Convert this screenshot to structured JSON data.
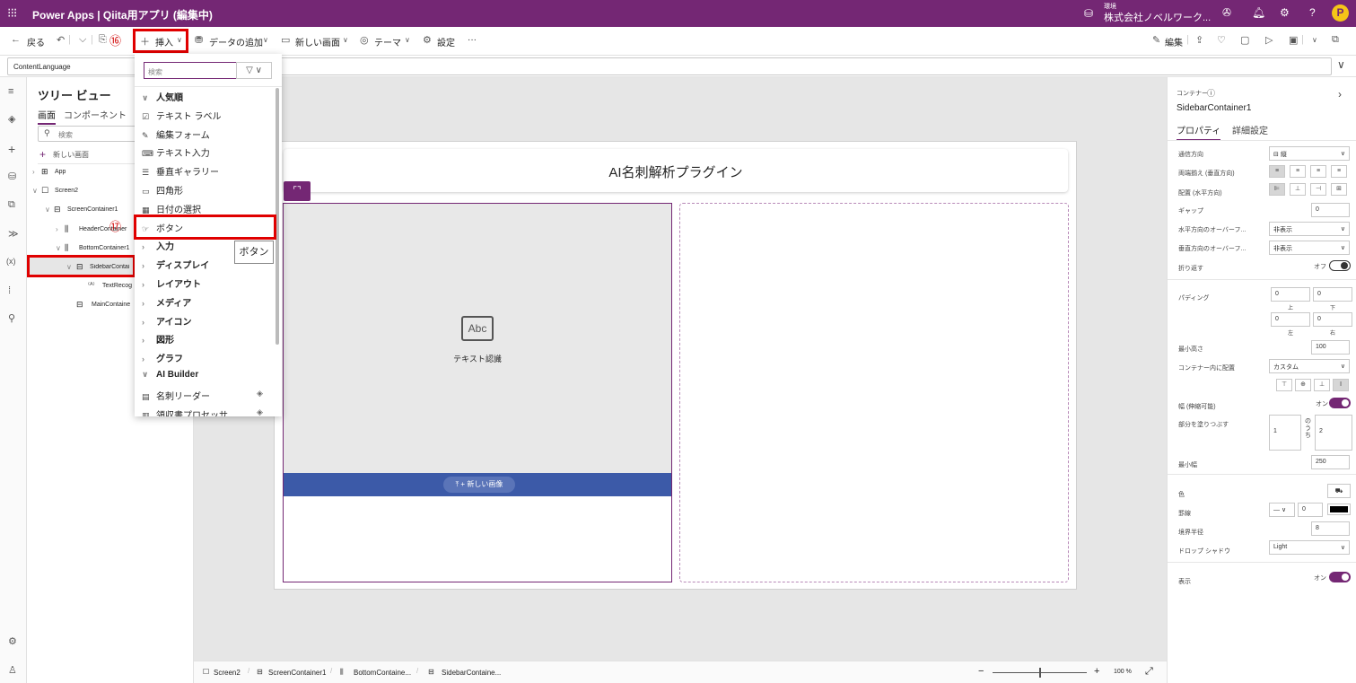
{
  "topbar": {
    "app_title": "Power Apps  |  Qiita用アプリ (編集中)",
    "env_label": "環境",
    "env_name": "株式会社ノベルワーク...",
    "avatar_letter": "P"
  },
  "cmdbar": {
    "back": "戻る",
    "step16": "⑯",
    "insert": "挿入",
    "add_data": "データの追加",
    "new_screen": "新しい画面",
    "theme": "テーマ",
    "settings": "設定",
    "more": "···",
    "edit": "編集"
  },
  "formula": {
    "property": "ContentLanguage"
  },
  "tree": {
    "title": "ツリー ビュー",
    "tab_screens": "画面",
    "tab_components": "コンポーネント",
    "search_placeholder": "検索",
    "new_screen": "新しい画面",
    "nodes": [
      "App",
      "Screen2",
      "ScreenContainer1",
      "HeaderContainer",
      "BottomContainer1",
      "SidebarContai",
      "TextRecog",
      "MainContaine"
    ]
  },
  "insert_menu": {
    "search_placeholder": "検索",
    "items": [
      {
        "label": "人気順",
        "kind": "cat-open"
      },
      {
        "label": "テキスト ラベル",
        "kind": "item",
        "icon": "label-icon"
      },
      {
        "label": "編集フォーム",
        "kind": "item",
        "icon": "form-icon"
      },
      {
        "label": "テキスト入力",
        "kind": "item",
        "icon": "textinput-icon"
      },
      {
        "label": "垂直ギャラリー",
        "kind": "item",
        "icon": "gallery-icon"
      },
      {
        "label": "四角形",
        "kind": "item",
        "icon": "rectangle-icon"
      },
      {
        "label": "日付の選択",
        "kind": "item",
        "icon": "calendar-icon"
      },
      {
        "label": "ボタン",
        "kind": "item",
        "icon": "button-icon"
      },
      {
        "label": "入力",
        "kind": "cat"
      },
      {
        "label": "ディスプレイ",
        "kind": "cat"
      },
      {
        "label": "レイアウト",
        "kind": "cat"
      },
      {
        "label": "メディア",
        "kind": "cat"
      },
      {
        "label": "アイコン",
        "kind": "cat"
      },
      {
        "label": "図形",
        "kind": "cat"
      },
      {
        "label": "グラフ",
        "kind": "cat"
      },
      {
        "label": "AI Builder",
        "kind": "cat-open-small"
      },
      {
        "label": "名刺リーダー",
        "kind": "item",
        "icon": "businesscard-icon"
      },
      {
        "label": "領収書プロセッサ",
        "kind": "item",
        "icon": "receipt-icon"
      }
    ],
    "step17": "⑰",
    "tooltip": "ボタン"
  },
  "canvas": {
    "header_title": "AI名刺解析プラグイン",
    "text_recognizer_label": "テキスト認識",
    "abc": "Abc",
    "new_image_button": "+ 新しい画像"
  },
  "status": {
    "crumbs": [
      "Screen2",
      "ScreenContainer1",
      "BottomContaine...",
      "SidebarContaine..."
    ],
    "zoom": "100 %"
  },
  "props": {
    "type_label": "コンテナー",
    "control_name": "SidebarContainer1",
    "tab_properties": "プロパティ",
    "tab_advanced": "詳細設定",
    "rows": {
      "direction": "通信方向",
      "direction_value": "縦",
      "justify": "両端揃え (垂直方向)",
      "align": "配置 (水平方向)",
      "gap": "ギャップ",
      "gap_value": "0",
      "overflow_h": "水平方向のオーバーフ...",
      "overflow_h_value": "非表示",
      "overflow_v": "垂直方向のオーバーフ...",
      "overflow_v_value": "非表示",
      "wrap": "折り返す",
      "wrap_state": "オフ",
      "padding": "パディング",
      "pad_top": "0",
      "pad_bottom": "0",
      "pad_left": "0",
      "pad_right": "0",
      "pad_top_label": "上",
      "pad_bottom_label": "下",
      "pad_left_label": "左",
      "pad_right_label": "右",
      "min_height": "最小高さ",
      "min_height_value": "100",
      "align_in_container": "コンテナー内に配置",
      "align_in_container_value": "カスタム",
      "flexible_width": "幅 (伸縮可能)",
      "flexible_width_state": "オン",
      "fill_portions": "部分を塗りつぶす",
      "fill_value": "1",
      "of_label": "のうち",
      "of_value": "2",
      "min_width": "最小幅",
      "min_width_value": "250",
      "color": "色",
      "border": "罫線",
      "border_value": "0",
      "radius": "境界半径",
      "radius_value": "8",
      "shadow": "ドロップ シャドウ",
      "shadow_value": "Light",
      "visible": "表示",
      "visible_state": "オン"
    }
  },
  "colors": {
    "brand": "#742774",
    "highlight": "#e00000",
    "new_image_bar": "#3c5aa8"
  }
}
